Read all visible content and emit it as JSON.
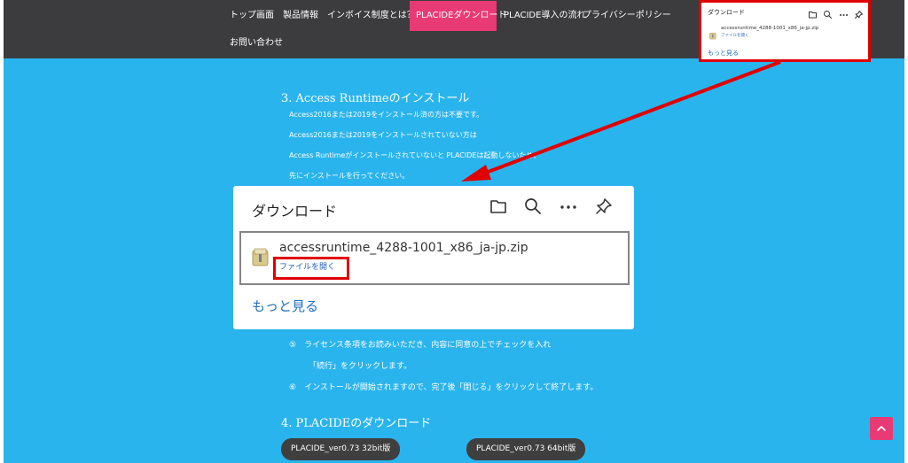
{
  "nav": {
    "items": [
      {
        "label": "トップ画面",
        "active": false
      },
      {
        "label": "製品情報",
        "active": false
      },
      {
        "label": "インボイス制度とは？",
        "active": false
      },
      {
        "label": "PLACIDEダウンロード",
        "active": true
      },
      {
        "label": "PLACIDE導入の流れ",
        "active": false
      },
      {
        "label": "プライバシーポリシー",
        "active": false
      },
      {
        "label": "お問い合わせ",
        "active": false
      }
    ]
  },
  "section3": {
    "heading": "3. Access Runtimeのインストール",
    "lines": [
      "Access2016または2019をインストール済の方は不要です。",
      "Access2016または2019をインストールされていない方は",
      "Access Runtimeがインストールされていないと PLACIDEは起動しないため、",
      "先にインストールを行ってください。"
    ]
  },
  "download_panel": {
    "title": "ダウンロード",
    "icons": [
      "folder-icon",
      "search-icon",
      "more-icon",
      "pin-icon"
    ],
    "file_name": "accessruntime_4288-1001_x86_ja-jp.zip",
    "open_link": "ファイルを開く",
    "more_link": "もっと見る"
  },
  "steps": {
    "step5_line1": "⑤　ライセンス条項をお読みいただき、内容に同意の上でチェックを入れ",
    "step5_line2": "「続行」をクリックします。",
    "step6": "⑥　インストールが開始されますので、完了後「閉じる」をクリックして終了します。"
  },
  "section4": {
    "heading": "4. PLACIDEのダウンロード",
    "buttons": [
      "PLACIDE_ver0.73 32bit版",
      "PLACIDE_ver0.73 64bit版"
    ]
  },
  "mini_popup": {
    "title": "ダウンロード",
    "file_name": "accessruntime_4288-1001_x86_ja-jp.zip",
    "open_link": "ファイルを開く",
    "more_link": "もっと見る"
  },
  "colors": {
    "nav_bg": "#3c3b3d",
    "accent_pink": "#e83a74",
    "content_bg": "#2ab4ed",
    "highlight_red": "#e00000",
    "button_bg": "#3f3f3f"
  }
}
